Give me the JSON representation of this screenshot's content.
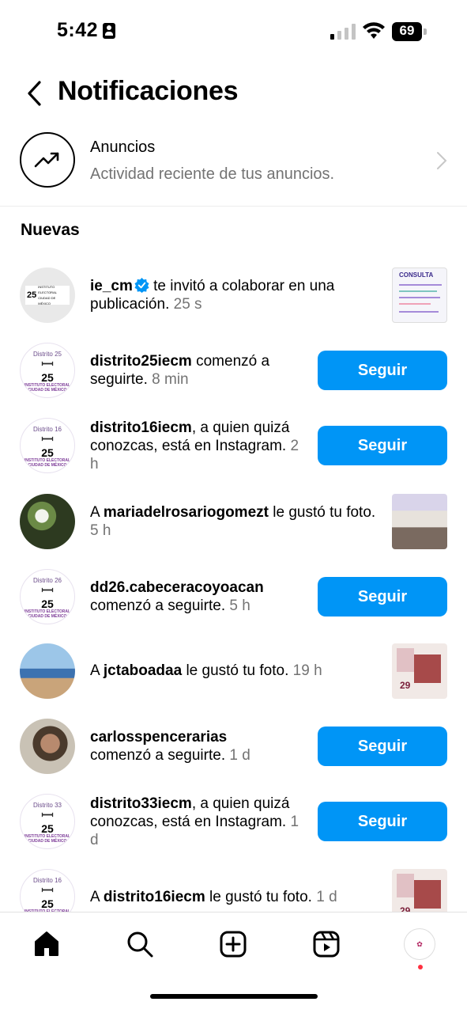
{
  "status_bar": {
    "time": "5:42",
    "battery": "69"
  },
  "header": {
    "title": "Notificaciones"
  },
  "ads": {
    "title": "Anuncios",
    "subtitle": "Actividad reciente de tus anuncios."
  },
  "section": {
    "title": "Nuevas"
  },
  "notifications": [
    {
      "prefix": "",
      "user": "ie_cm",
      "verified": true,
      "text": " te invitó a colaborar en una publicación.",
      "time": "25 s",
      "action": "thumbnail"
    },
    {
      "prefix": "",
      "user": "distrito25iecm",
      "text": " comenzó a seguirte.",
      "time": "8 min",
      "action": "follow",
      "avatar_district": "Distrito 25"
    },
    {
      "prefix": "",
      "user": "distrito16iecm",
      "text": ", a quien quizá conozcas, está en Instagram.",
      "time": "2 h",
      "action": "follow",
      "avatar_district": "Distrito 16"
    },
    {
      "prefix": "A ",
      "user": "mariadelrosariogomezt",
      "text": " le gustó tu foto.",
      "time": "5 h",
      "action": "thumbnail"
    },
    {
      "prefix": "",
      "user": "dd26.cabeceracoyoacan",
      "text": " comenzó a seguirte.",
      "time": "5 h",
      "action": "follow",
      "avatar_district": "Distrito 26"
    },
    {
      "prefix": "A ",
      "user": "jctaboadaa",
      "text": " le gustó tu foto.",
      "time": "19 h",
      "action": "thumbnail"
    },
    {
      "prefix": "",
      "user": "carlosspencerarias",
      "text": " comenzó a seguirte.",
      "time": "1 d",
      "action": "follow"
    },
    {
      "prefix": "",
      "user": "distrito33iecm",
      "text": ", a quien quizá conozcas, está en Instagram.",
      "time": "1 d",
      "action": "follow",
      "avatar_district": "Distrito 33"
    },
    {
      "prefix": "A ",
      "user": "distrito16iecm",
      "text": " le gustó tu foto.",
      "time": "1 d",
      "action": "thumbnail",
      "avatar_district": "Distrito 16"
    }
  ],
  "buttons": {
    "follow": "Seguir"
  },
  "thumbnails": {
    "consulta_title": "CONSULTA",
    "poster_number": "29"
  },
  "avatar_logo": {
    "number": "25",
    "org": "INSTITUTO ELECTORAL CIUDAD DE MÉXICO"
  },
  "colors": {
    "accent": "#0095f6",
    "secondary_text": "#737373",
    "notification_dot": "#ff3040"
  },
  "nav": {
    "items": [
      "home-icon",
      "search-icon",
      "create-icon",
      "reels-icon",
      "profile-avatar"
    ]
  }
}
